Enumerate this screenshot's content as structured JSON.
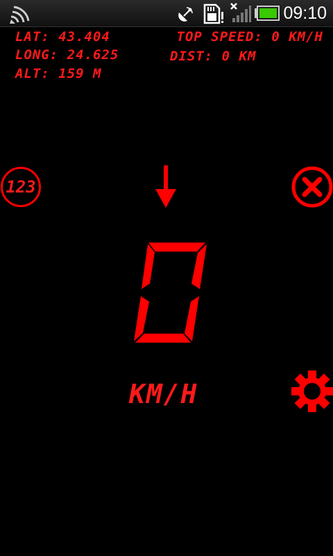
{
  "status_bar": {
    "time": "09:10",
    "icons": [
      "signal-sweep-icon",
      "satellite-dish-icon",
      "sd-card-icon",
      "signal-bars-icon",
      "battery-icon"
    ],
    "battery_color": "#39c900"
  },
  "info": {
    "lat": "LAT: 43.404",
    "long": "LONG: 24.625",
    "alt": "ALT: 159 M",
    "top_speed": "TOP SPEED: 0 KM/H",
    "dist": "DIST: 0 KM"
  },
  "controls": {
    "digits_button_label": "123",
    "close_icon": "close-icon",
    "settings_icon": "gear-icon"
  },
  "speed": {
    "value": "0",
    "unit": "KM/H"
  },
  "theme": {
    "accent": "#ff0000",
    "background": "#000000"
  }
}
